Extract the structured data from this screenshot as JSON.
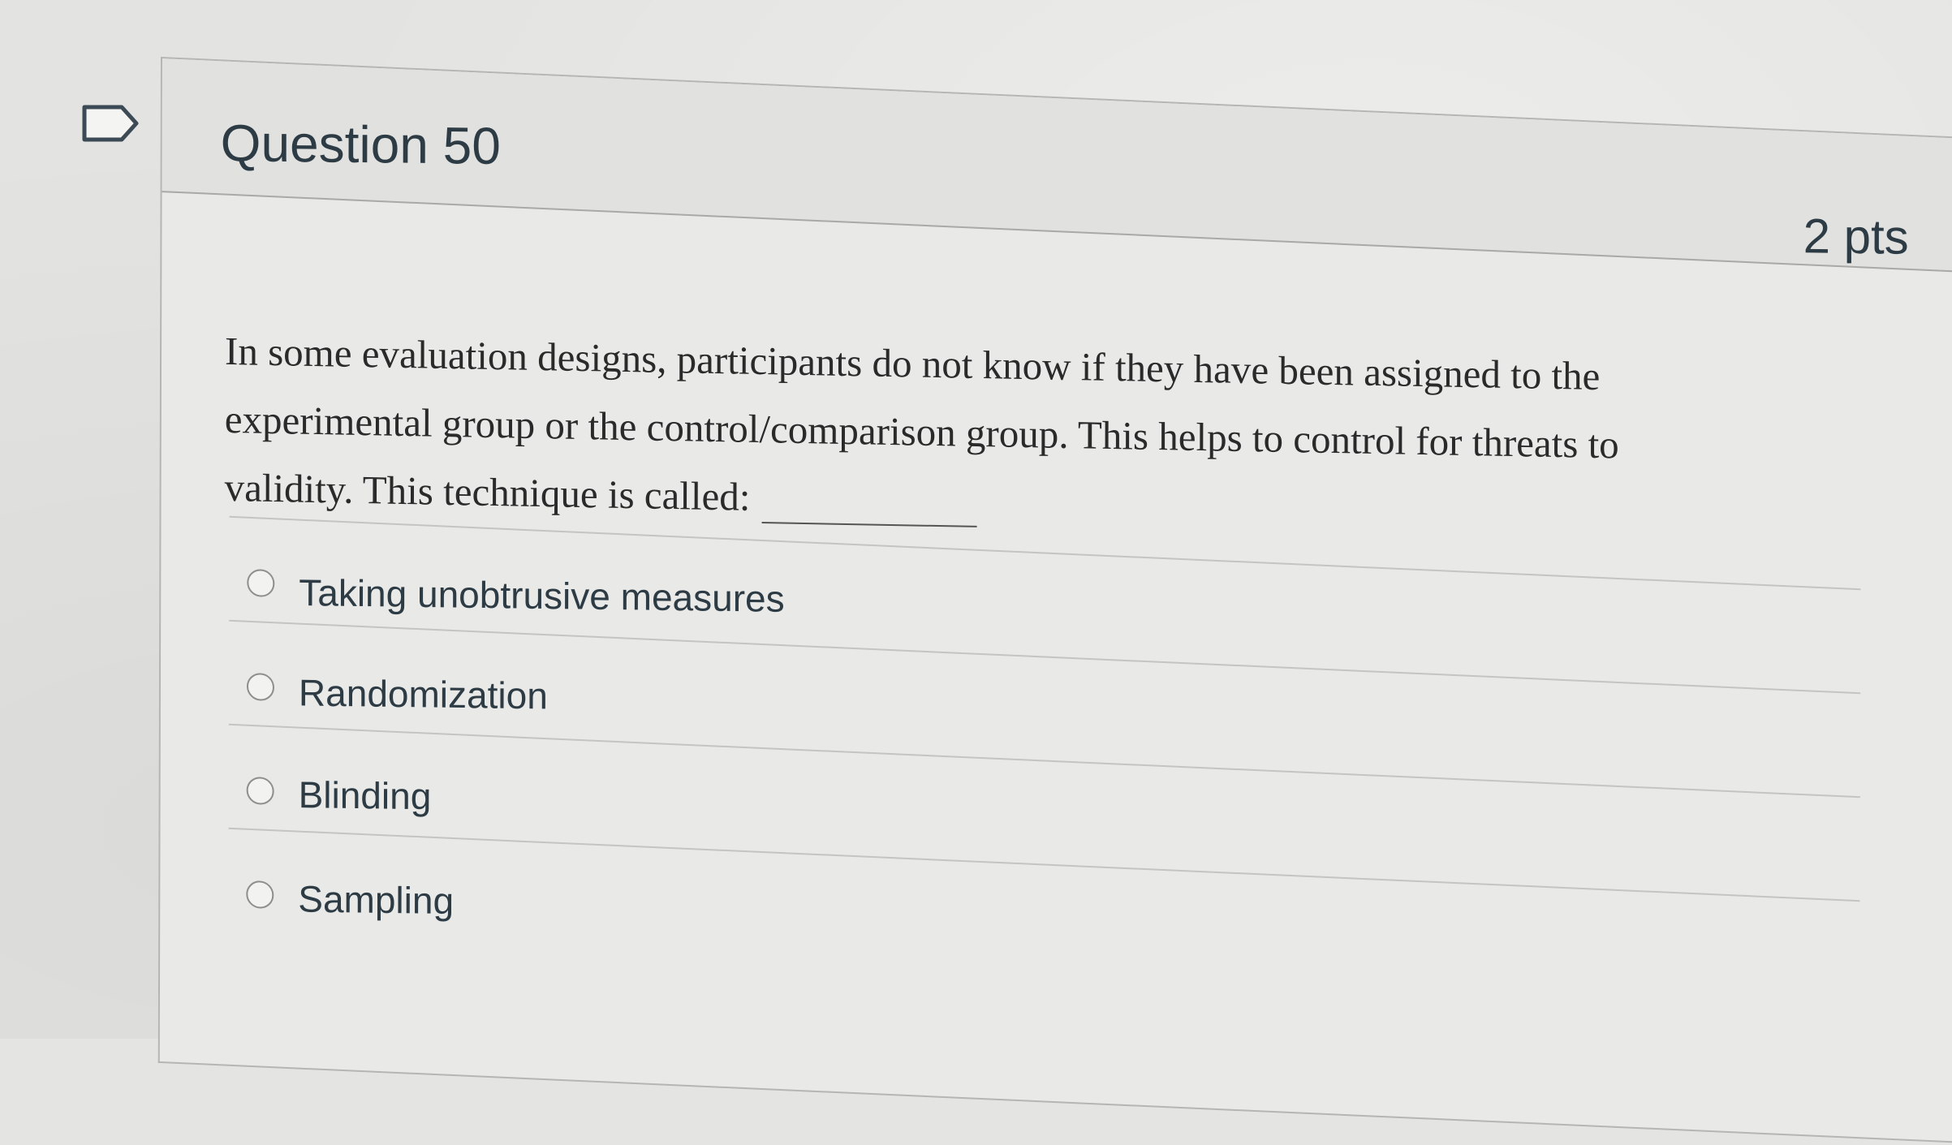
{
  "question": {
    "title": "Question 50",
    "points": "2 pts",
    "flag_icon": "flag-outline-icon",
    "text_lines": [
      "In some evaluation designs, participants do not know if they have been assigned to the",
      "experimental group or the control/comparison group.  This helps to control for threats to",
      "validity. This technique is called:"
    ],
    "answers": [
      {
        "label": "Taking unobtrusive measures",
        "selected": false
      },
      {
        "label": "Randomization",
        "selected": false
      },
      {
        "label": "Blinding",
        "selected": false
      },
      {
        "label": "Sampling",
        "selected": false
      }
    ]
  },
  "colors": {
    "heading_text": "#2d3b45",
    "body_text": "#2a2a2a",
    "border": "#b5b5b3",
    "background": "#e3e3e1"
  }
}
